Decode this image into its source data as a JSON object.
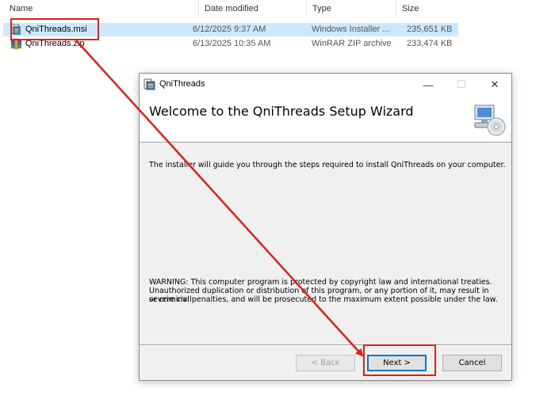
{
  "explorer": {
    "columns": {
      "name": "Name",
      "date_modified": "Date modified",
      "type": "Type",
      "size": "Size"
    },
    "files": [
      {
        "name": "QniThreads.msi",
        "date": "6/12/2025 9:37 AM",
        "type": "Windows Installer ...",
        "size": "235,651 KB",
        "icon": "msi-installer-icon",
        "selected": true
      },
      {
        "name": "QniThreads.zip",
        "date": "6/13/2025 10:35 AM",
        "type": "WinRAR ZIP archive",
        "size": "233,474 KB",
        "icon": "winrar-archive-icon",
        "selected": false
      }
    ]
  },
  "dialog": {
    "title": "QniThreads",
    "window_controls": {
      "minimize": "—",
      "maximize": "☐",
      "close": "✕"
    },
    "heading": "Welcome to the QniThreads Setup Wizard",
    "intro": "The installer will guide you through the steps required to install QniThreads on your computer.",
    "warning": [
      "WARNING: This computer program is protected by copyright law and international treaties.",
      "Unauthorized duplication or distribution of this program, or any portion of it, may result in severe civil",
      "or criminal penalties, and will be prosecuted to the maximum extent possible under the law."
    ],
    "buttons": {
      "back": "< Back",
      "next": "Next >",
      "cancel": "Cancel"
    }
  },
  "annotation": {
    "color": "#e0201a"
  }
}
